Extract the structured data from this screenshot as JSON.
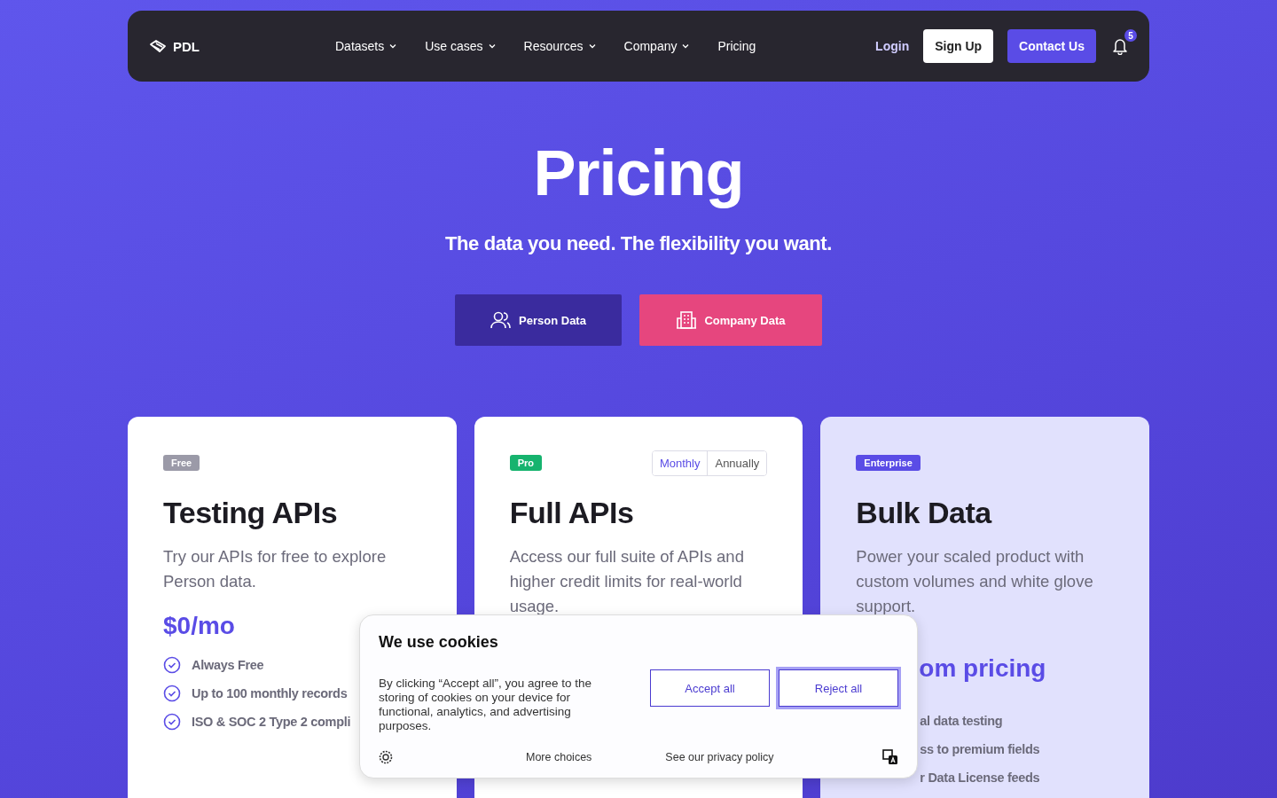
{
  "nav": {
    "logo": "PDL",
    "links": [
      {
        "label": "Datasets",
        "dropdown": true
      },
      {
        "label": "Use cases",
        "dropdown": true
      },
      {
        "label": "Resources",
        "dropdown": true
      },
      {
        "label": "Company",
        "dropdown": true
      },
      {
        "label": "Pricing",
        "dropdown": false
      }
    ],
    "login": "Login",
    "signup": "Sign Up",
    "contact": "Contact Us",
    "notifications": "5"
  },
  "hero": {
    "title": "Pricing",
    "subtitle": "The data you need. The flexibility you want.",
    "toggles": [
      {
        "label": "Person Data",
        "kind": "person",
        "selected": true
      },
      {
        "label": "Company Data",
        "kind": "company",
        "selected": false
      }
    ]
  },
  "plans": [
    {
      "kind": "free",
      "badge": "Free",
      "color": "#9b9aa8",
      "title": "Testing APIs",
      "description": "Try our APIs for free to explore Person data.",
      "price": "$0/mo",
      "features": [
        "Always Free",
        "Up to 100 monthly records",
        "ISO & SOC 2 Type 2 compli"
      ]
    },
    {
      "kind": "pro",
      "badge": "Pro",
      "color": "#16b36e",
      "title": "Full APIs",
      "description": "Access our full suite of APIs and higher credit limits for real-world usage.",
      "billing": [
        {
          "label": "Monthly",
          "selected": true
        },
        {
          "label": "Annually",
          "selected": false
        }
      ]
    },
    {
      "kind": "enterprise",
      "badge": "Enterprise",
      "color": "#5a4ce6",
      "title": "Bulk Data",
      "description": "Power your scaled product with custom volumes and white glove support.",
      "price": "om pricing",
      "features": [
        "al data testing",
        "ss to premium fields",
        "r Data License feeds"
      ]
    }
  ],
  "cookie_dialog": {
    "title": "We use cookies",
    "text": "By clicking “Accept all”, you agree to the storing of cookies on your device for functional, analytics, and advertising purposes.",
    "buttons": [
      "Accept all",
      "Reject all"
    ],
    "links": [
      "More choices",
      "See our privacy policy"
    ]
  }
}
